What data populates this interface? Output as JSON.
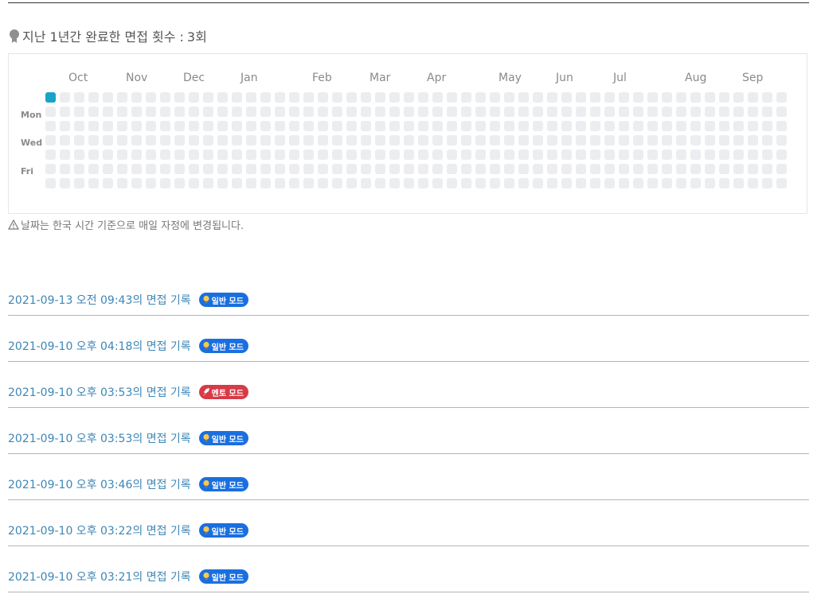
{
  "summary": {
    "label": "지난 1년간 완료한 면접 횟수 :",
    "count": "3회",
    "icon": "medal-icon"
  },
  "calendar": {
    "months": [
      "Oct",
      "Nov",
      "Dec",
      "Jan",
      "Feb",
      "Mar",
      "Apr",
      "May",
      "Jun",
      "Jul",
      "Aug",
      "Sep"
    ],
    "day_labels": [
      "Mon",
      "Wed",
      "Fri"
    ],
    "colors": {
      "empty": "#ebedf0",
      "active": "#1aa3c9"
    }
  },
  "notice": {
    "icon": "warning-icon",
    "text": "날짜는 한국 시간 기준으로 매일 자정에 변경됩니다."
  },
  "records": [
    {
      "text": "2021-09-13 오전 09:43의 면접 기록",
      "badge": "일반 모드",
      "type": "normal"
    },
    {
      "text": "2021-09-10 오후 04:18의 면접 기록",
      "badge": "일반 모드",
      "type": "normal"
    },
    {
      "text": "2021-09-10 오후 03:53의 면접 기록",
      "badge": "멘토 모드",
      "type": "mentor"
    },
    {
      "text": "2021-09-10 오후 03:53의 면접 기록",
      "badge": "일반 모드",
      "type": "normal"
    },
    {
      "text": "2021-09-10 오후 03:46의 면접 기록",
      "badge": "일반 모드",
      "type": "normal"
    },
    {
      "text": "2021-09-10 오후 03:22의 면접 기록",
      "badge": "일반 모드",
      "type": "normal"
    },
    {
      "text": "2021-09-10 오후 03:21의 면접 기록",
      "badge": "일반 모드",
      "type": "normal"
    }
  ],
  "badge_colors": {
    "normal": "#1a6fe0",
    "mentor": "#d73b47"
  },
  "badge_icons": {
    "normal": "lightbulb-icon",
    "mentor": "rocket-icon"
  }
}
